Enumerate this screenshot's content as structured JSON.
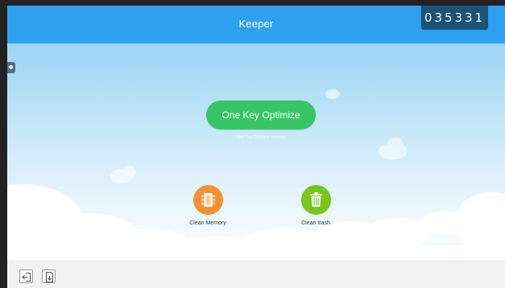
{
  "app": {
    "title": "Keeper",
    "counter": "035331"
  },
  "optimize": {
    "button_label": "One Key Optimize",
    "subtitle": "One Key Optimize memory"
  },
  "actions": [
    {
      "label": "Clean Memory",
      "icon": "memory-chip-icon",
      "color": "#f29333"
    },
    {
      "label": "Clean trash",
      "icon": "trash-icon",
      "color": "#78c51c"
    }
  ],
  "bottom_toolbar": {
    "buttons": [
      {
        "icon": "exit-icon"
      },
      {
        "icon": "document-icon"
      }
    ]
  },
  "colors": {
    "topbar": "#2ea0ee",
    "counter_bg": "#1b5276",
    "optimize_button": "#37c566"
  }
}
